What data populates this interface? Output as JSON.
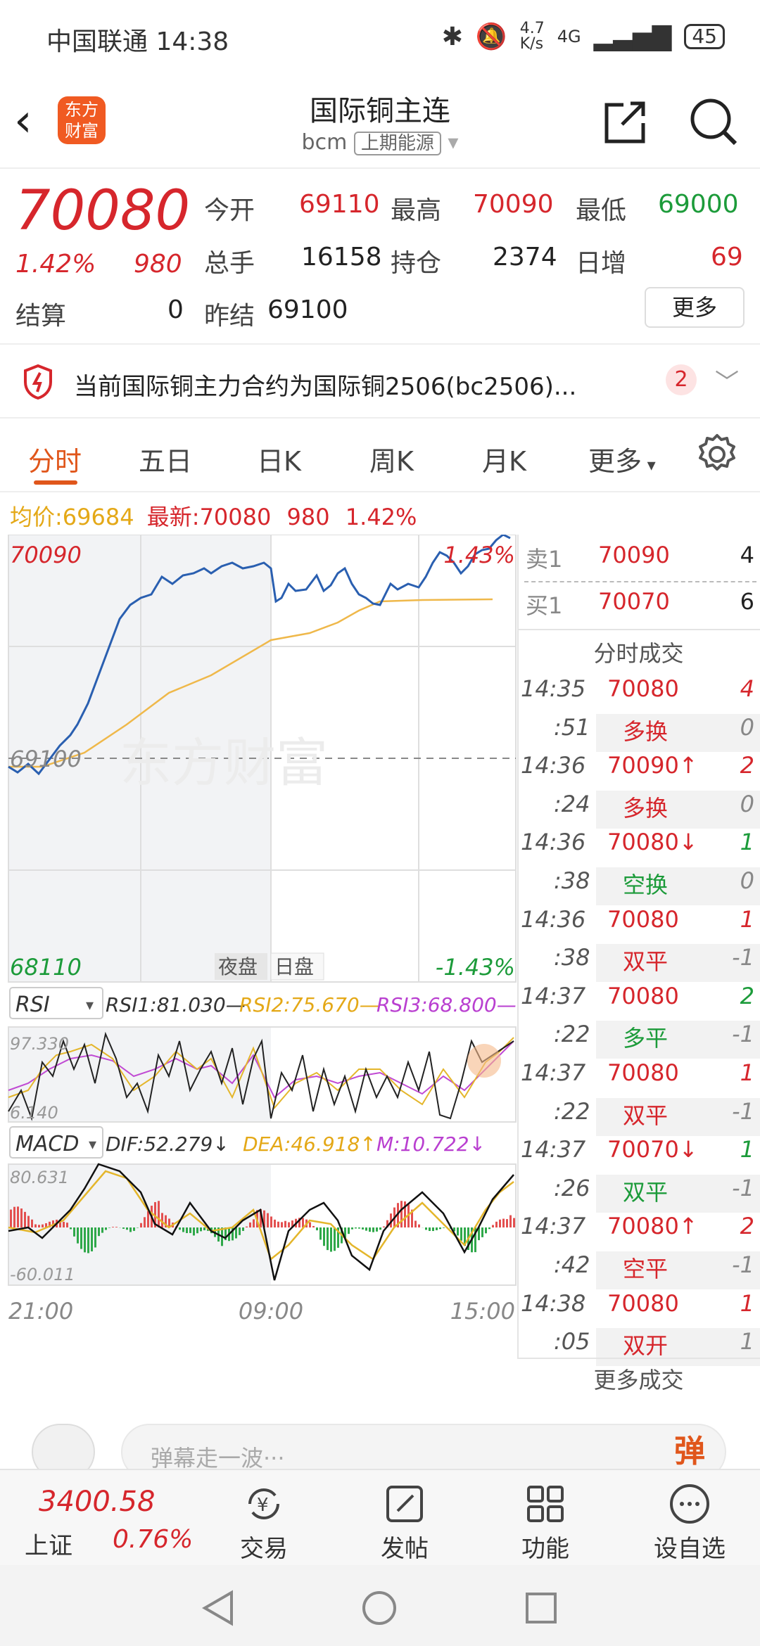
{
  "status": {
    "carrier": "中国联通 14:38",
    "speed": "4.7\nK/s",
    "net": "4G",
    "battery": "45"
  },
  "nav": {
    "logo_line1": "东方",
    "logo_line2": "财富",
    "title": "国际铜主连",
    "code": "bcm",
    "source": "上期能源"
  },
  "quote": {
    "price": "70080",
    "pct": "1.42%",
    "chg": "980",
    "open_label": "今开",
    "open": "69110",
    "high_label": "最高",
    "high": "70090",
    "low_label": "最低",
    "low": "69000",
    "vol_label": "总手",
    "vol": "16158",
    "oi_label": "持仓",
    "oi": "2374",
    "inc_label": "日增",
    "inc": "69",
    "settle_label": "结算",
    "settle": "0",
    "prev_label": "昨结",
    "prev": "69100",
    "more": "更多"
  },
  "notice": {
    "text": "当前国际铜主力合约为国际铜2506(bc2506)...",
    "count": "2"
  },
  "tabs": {
    "t1": "分时",
    "t2": "五日",
    "t3": "日K",
    "t4": "周K",
    "t5": "月K",
    "t6": "更多"
  },
  "avg": {
    "avg_label": "均价:",
    "avg": "69684",
    "last_label": "最新:",
    "last": "70080",
    "chg": "980",
    "pct": "1.42%"
  },
  "main": {
    "ymax": "70090",
    "ymin": "68110",
    "base": "69100",
    "pmax": "1.43%",
    "pmin": "-1.43%",
    "watermark": "东方财富",
    "session1": "夜盘",
    "session2": "日盘"
  },
  "rsi": {
    "sel": "RSI",
    "r1": "RSI1:81.030—",
    "r2": "RSI2:75.670—",
    "r3": "RSI3:68.800—",
    "top": "97.330",
    "bottom": "6.140"
  },
  "macd": {
    "sel": "MACD",
    "dif": "DIF:52.279↓",
    "dea": "DEA:46.918↑",
    "m": "M:10.722↓",
    "top": "80.631",
    "bottom": "-60.011"
  },
  "times": {
    "t1": "21:00",
    "t2": "09:00",
    "t3": "15:00"
  },
  "orderbook": {
    "sell_label": "卖1",
    "sell_price": "70090",
    "sell_vol": "4",
    "buy_label": "买1",
    "buy_price": "70070",
    "buy_vol": "6",
    "trades_title": "分时成交",
    "more": "更多成交",
    "trades": [
      {
        "t": "14:35",
        "p": "70080",
        "v": "4",
        "pc": "red",
        "vc": "red"
      },
      {
        "t": ":51",
        "p": "多换",
        "v": "0",
        "pc": "red",
        "vc": "gray",
        "sub": true
      },
      {
        "t": "14:36",
        "p": "70090↑",
        "v": "2",
        "pc": "red",
        "vc": "red"
      },
      {
        "t": ":24",
        "p": "多换",
        "v": "0",
        "pc": "red",
        "vc": "gray",
        "sub": true
      },
      {
        "t": "14:36",
        "p": "70080↓",
        "v": "1",
        "pc": "red",
        "vc": "green"
      },
      {
        "t": ":38",
        "p": "空换",
        "v": "0",
        "pc": "green",
        "vc": "gray",
        "sub": true
      },
      {
        "t": "14:36",
        "p": "70080",
        "v": "1",
        "pc": "red",
        "vc": "red"
      },
      {
        "t": ":38",
        "p": "双平",
        "v": "-1",
        "pc": "red",
        "vc": "gray",
        "sub": true
      },
      {
        "t": "14:37",
        "p": "70080",
        "v": "2",
        "pc": "red",
        "vc": "green"
      },
      {
        "t": ":22",
        "p": "多平",
        "v": "-1",
        "pc": "green",
        "vc": "gray",
        "sub": true
      },
      {
        "t": "14:37",
        "p": "70080",
        "v": "1",
        "pc": "red",
        "vc": "red"
      },
      {
        "t": ":22",
        "p": "双平",
        "v": "-1",
        "pc": "red",
        "vc": "gray",
        "sub": true
      },
      {
        "t": "14:37",
        "p": "70070↓",
        "v": "1",
        "pc": "red",
        "vc": "green"
      },
      {
        "t": ":26",
        "p": "双平",
        "v": "-1",
        "pc": "green",
        "vc": "gray",
        "sub": true
      },
      {
        "t": "14:37",
        "p": "70080↑",
        "v": "2",
        "pc": "red",
        "vc": "red"
      },
      {
        "t": ":42",
        "p": "空平",
        "v": "-1",
        "pc": "red",
        "vc": "gray",
        "sub": true
      },
      {
        "t": "14:38",
        "p": "70080",
        "v": "1",
        "pc": "red",
        "vc": "red"
      },
      {
        "t": ":05",
        "p": "双开",
        "v": "1",
        "pc": "red",
        "vc": "gray",
        "sub": true
      }
    ]
  },
  "input": {
    "placeholder": "弹幕走一波···",
    "btn": "弹"
  },
  "tabbar": {
    "index_value": "3400.58",
    "index_name": "上证",
    "index_pct": "0.76%",
    "trade": "交易",
    "post": "发帖",
    "func": "功能",
    "watch": "设自选"
  }
}
